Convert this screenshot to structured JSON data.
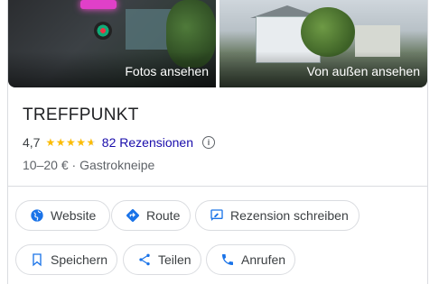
{
  "photos": {
    "left_caption": "Fotos ansehen",
    "right_caption": "Von außen ansehen"
  },
  "place": {
    "name": "TREFFPUNKT",
    "rating": "4,7",
    "stars_value": 4.7,
    "reviews": "82 Rezensionen",
    "price_range": "10–20 €",
    "separator": "·",
    "category": "Gastrokneipe"
  },
  "actions": {
    "website": "Website",
    "route": "Route",
    "write_review": "Rezension schreiben",
    "save": "Speichern",
    "share": "Teilen",
    "call": "Anrufen"
  },
  "colors": {
    "accent_blue": "#1a73e8",
    "star": "#fbbc04",
    "link": "#1a0dab"
  },
  "icons": {
    "website": "globe-icon",
    "route": "directions-icon",
    "write_review": "review-icon",
    "save": "bookmark-icon",
    "share": "share-icon",
    "call": "phone-icon"
  }
}
